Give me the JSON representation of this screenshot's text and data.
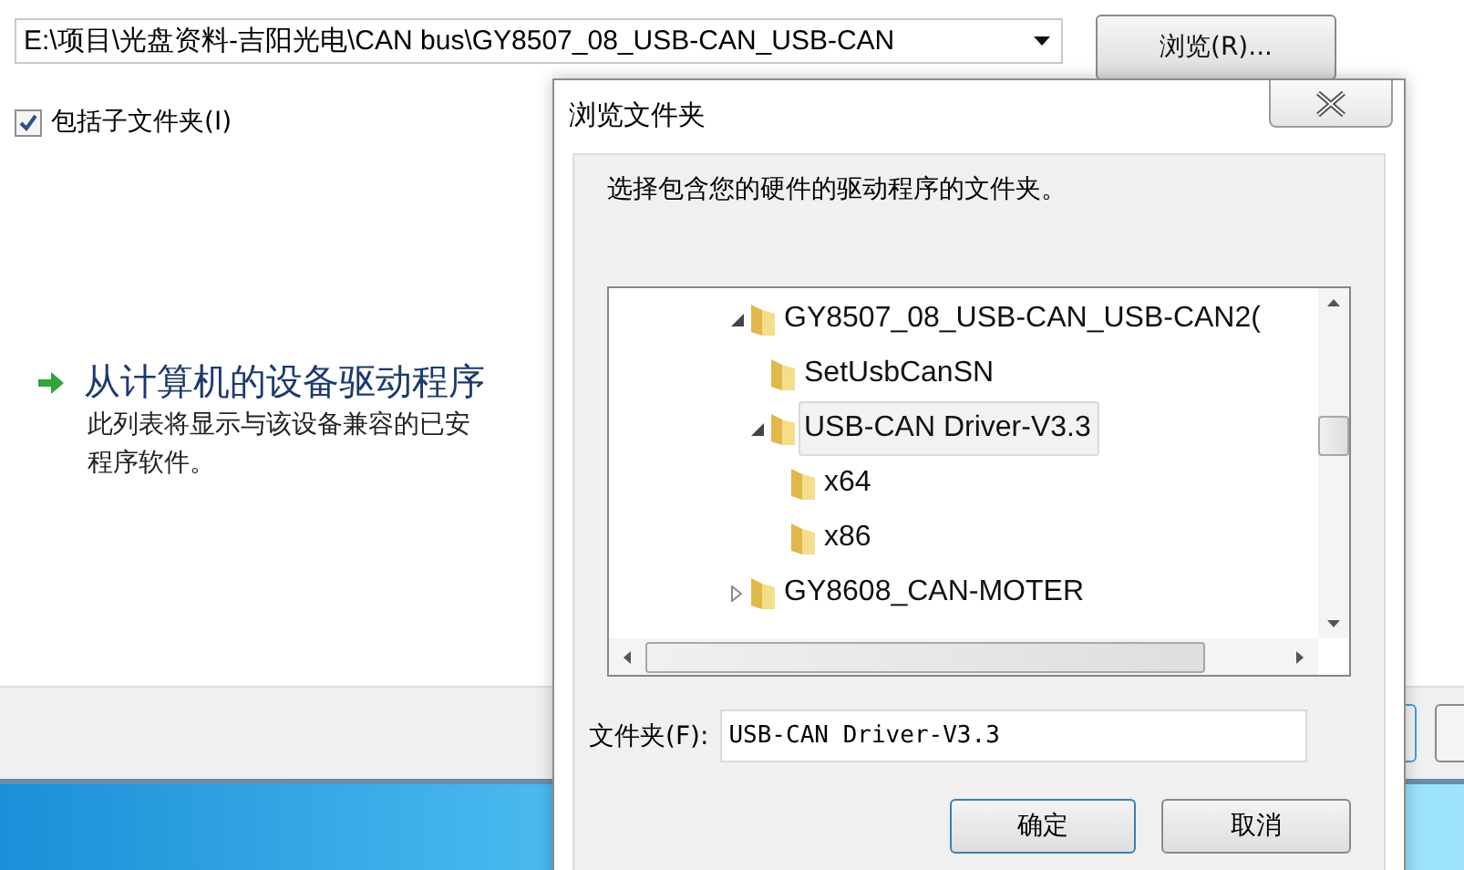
{
  "background_window": {
    "path_combo": {
      "value": "E:\\项目\\光盘资料-吉阳光电\\CAN bus\\GY8507_08_USB-CAN_USB-CAN"
    },
    "browse_button": "浏览(R)...",
    "include_subfolders": {
      "label": "包括子文件夹(I)",
      "checked": true
    },
    "option": {
      "title": "从计算机的设备驱动程序",
      "description": "此列表将显示与该设备兼容的已安",
      "description_2": "程序软件。"
    }
  },
  "dialog": {
    "title": "浏览文件夹",
    "prompt": "选择包含您的硬件的驱动程序的文件夹。",
    "tree": [
      {
        "label": "GY8507_08_USB-CAN_USB-CAN2(",
        "expanded": true,
        "selected": false,
        "children": [
          {
            "label": "SetUsbCanSN",
            "selected": false
          },
          {
            "label": "USB-CAN Driver-V3.3",
            "expanded": true,
            "selected": true,
            "children": [
              {
                "label": "x64",
                "selected": false
              },
              {
                "label": "x86",
                "selected": false
              }
            ]
          }
        ]
      },
      {
        "label": "GY8608_CAN-MOTER",
        "expanded": false,
        "selected": false
      }
    ],
    "folder_label": "文件夹(F):",
    "folder_value": "USB-CAN Driver-V3.3",
    "buttons": [
      "确定",
      "取消"
    ]
  }
}
